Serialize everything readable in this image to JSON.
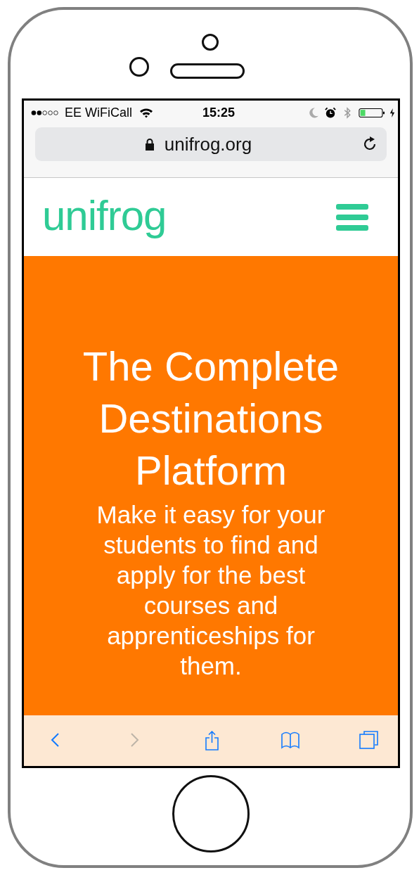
{
  "status_bar": {
    "carrier": "EE WiFiCall",
    "time": "15:25"
  },
  "address_bar": {
    "url": "unifrog.org",
    "secure": true
  },
  "site_header": {
    "logo": "unifrog"
  },
  "hero": {
    "title": "The Complete Destinations Platform",
    "subtitle": "Make it easy for your students to find and apply for the best courses and apprenticeships for them."
  },
  "toolbar": [
    {
      "kind": "back",
      "disabled": false
    },
    {
      "kind": "forward",
      "disabled": true
    },
    {
      "kind": "share",
      "disabled": false
    },
    {
      "kind": "bookmarks",
      "disabled": false
    },
    {
      "kind": "tabs",
      "disabled": false
    }
  ]
}
